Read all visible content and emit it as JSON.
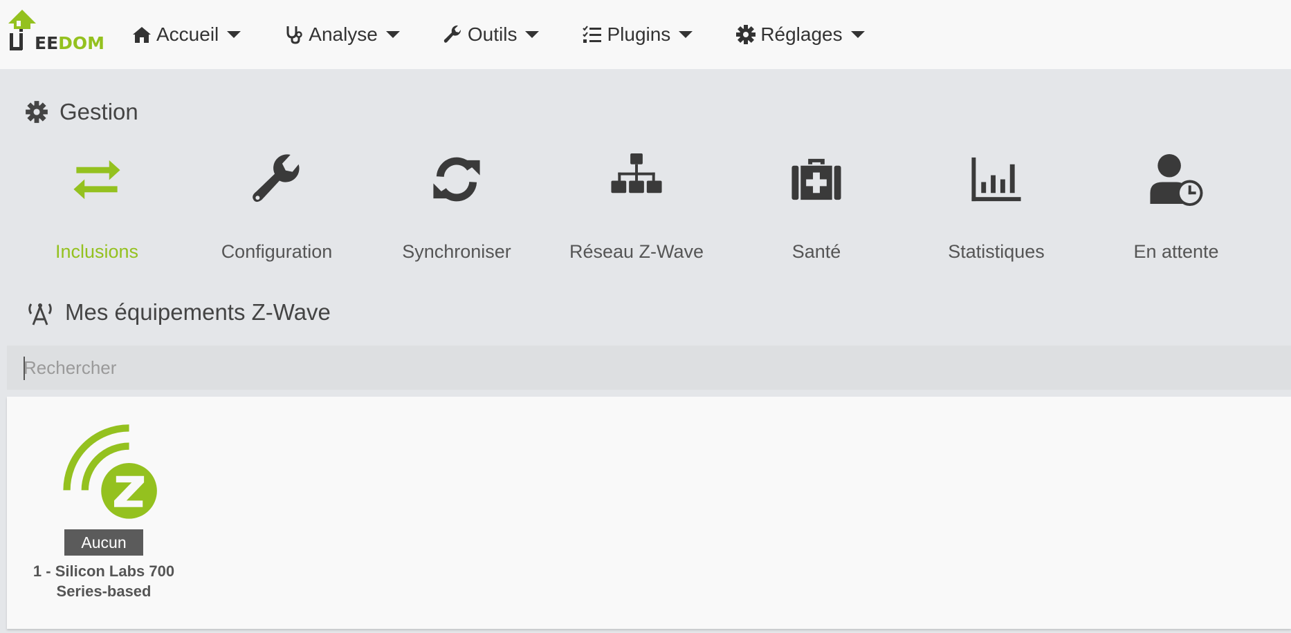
{
  "colors": {
    "accent": "#94c11f",
    "icon": "#3a3a3a",
    "badge": "#5b5b5b"
  },
  "logo": {
    "text_part1": "EE",
    "text_part2": "DOM"
  },
  "nav": [
    {
      "label": "Accueil",
      "icon": "home-icon"
    },
    {
      "label": "Analyse",
      "icon": "stethoscope-icon"
    },
    {
      "label": "Outils",
      "icon": "wrench-icon"
    },
    {
      "label": "Plugins",
      "icon": "tasks-list-icon"
    },
    {
      "label": "Réglages",
      "icon": "gear-icon"
    }
  ],
  "gestion": {
    "title": "Gestion",
    "cards": [
      {
        "label": "Inclusions",
        "icon": "exchange-arrows-icon",
        "active": true
      },
      {
        "label": "Configuration",
        "icon": "wrench-icon"
      },
      {
        "label": "Synchroniser",
        "icon": "sync-icon"
      },
      {
        "label": "Réseau Z-Wave",
        "icon": "network-tree-icon"
      },
      {
        "label": "Santé",
        "icon": "medkit-icon"
      },
      {
        "label": "Statistiques",
        "icon": "bar-chart-icon"
      },
      {
        "label": "En attente",
        "icon": "user-clock-icon"
      }
    ]
  },
  "equipments": {
    "title": "Mes équipements Z-Wave",
    "search_placeholder": "Rechercher",
    "items": [
      {
        "badge": "Aucun",
        "name": "1 - Silicon Labs 700 Series-based",
        "icon": "zwave-controller-icon"
      }
    ]
  }
}
